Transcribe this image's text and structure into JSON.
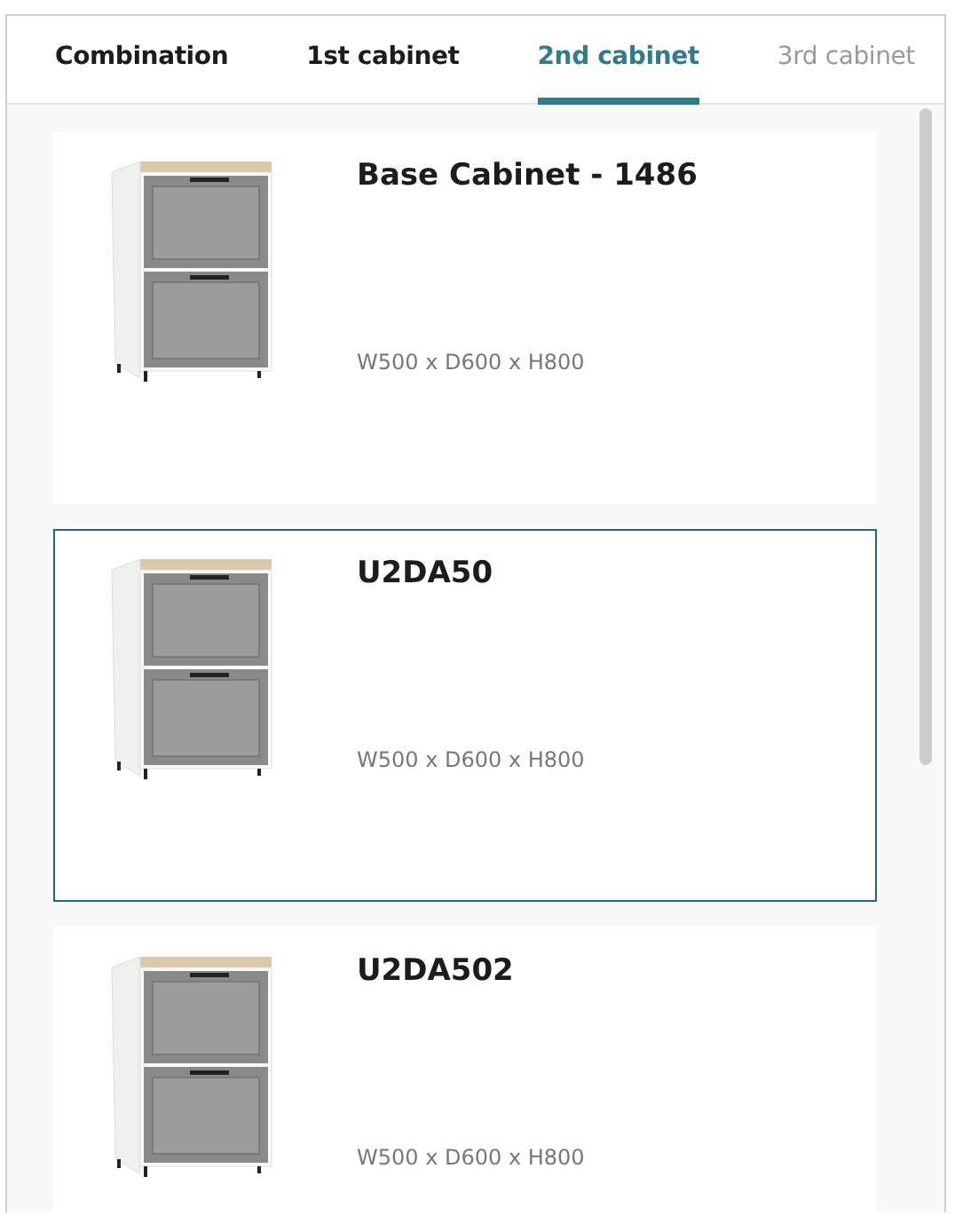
{
  "tabs": [
    {
      "label": "Combination",
      "selected": false,
      "disabled": false
    },
    {
      "label": "1st cabinet",
      "selected": false,
      "disabled": false
    },
    {
      "label": "2nd cabinet",
      "selected": true,
      "disabled": false
    },
    {
      "label": "3rd cabinet",
      "selected": false,
      "disabled": true
    }
  ],
  "products": [
    {
      "title": "Base Cabinet - 1486",
      "dimensions": "W500 x D600 x H800",
      "selected": false
    },
    {
      "title": "U2DA50",
      "dimensions": "W500 x D600 x H800",
      "selected": true
    },
    {
      "title": "U2DA502",
      "dimensions": "W500 x D600 x H800",
      "selected": false
    }
  ]
}
